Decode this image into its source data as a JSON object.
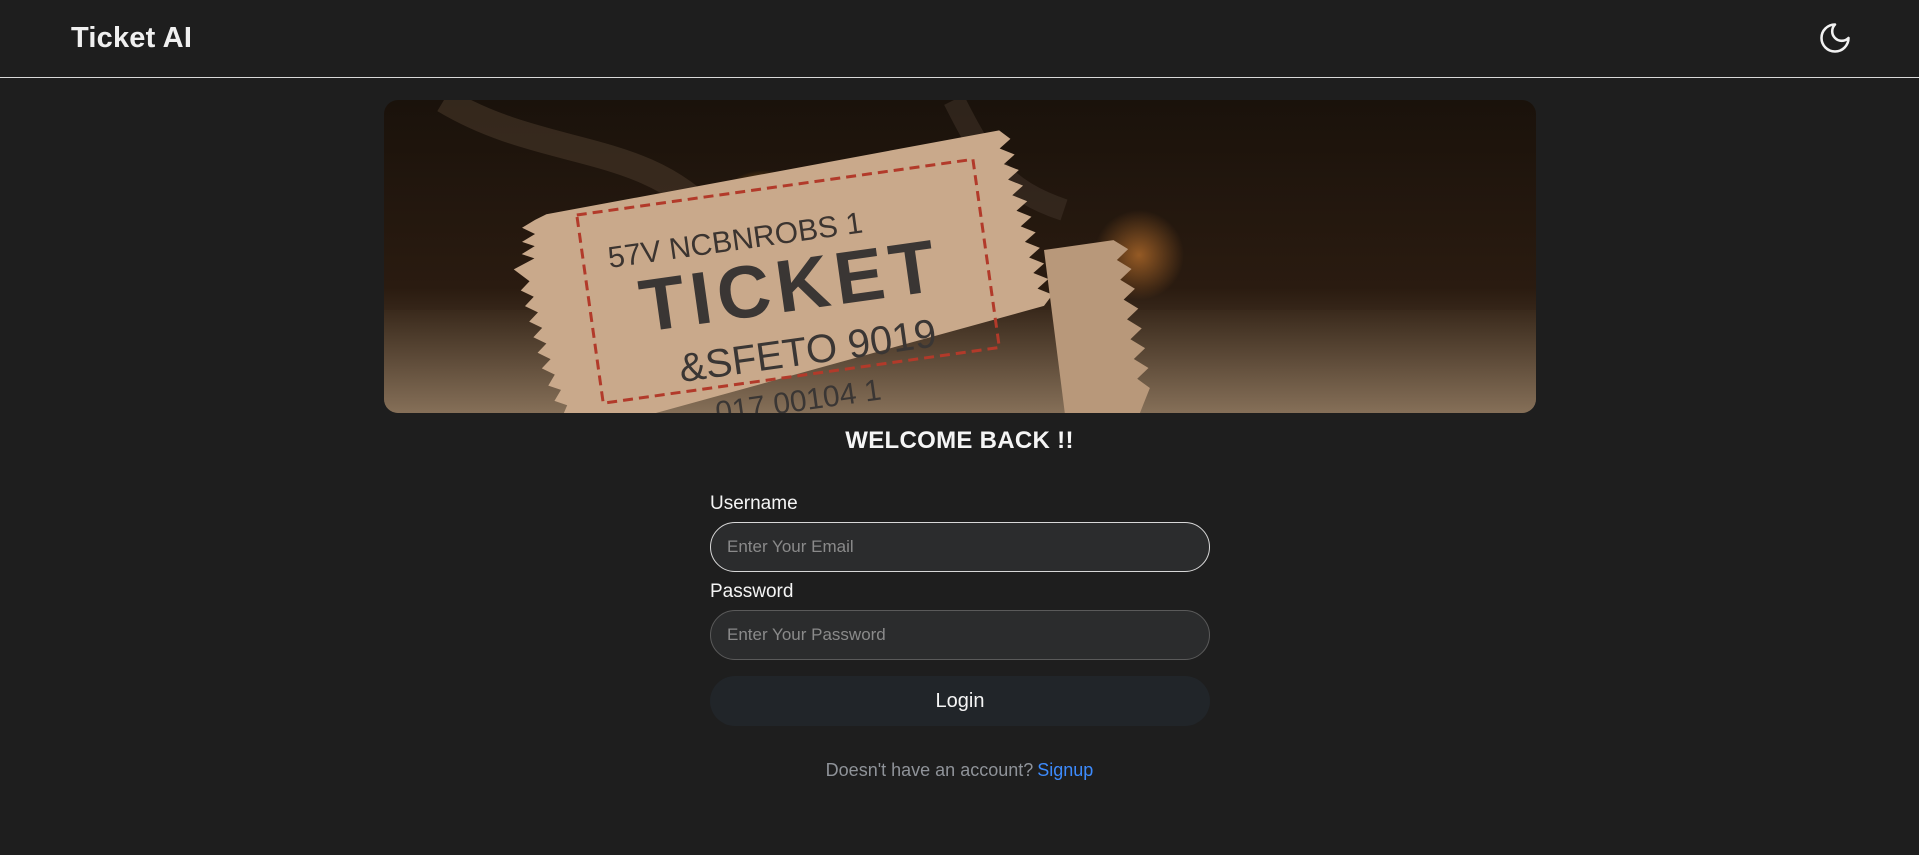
{
  "app": {
    "title": "Ticket AI"
  },
  "header": {
    "theme_toggle_icon": "moon-icon"
  },
  "hero": {
    "ticket_line1": "57V  NCBNROBS  1",
    "ticket_main": "TICKET",
    "ticket_line2": "&SFETO 9019",
    "ticket_line3": "017 00104 1"
  },
  "login": {
    "heading": "WELCOME BACK !!",
    "username_label": "Username",
    "username_placeholder": "Enter Your Email",
    "password_label": "Password",
    "password_placeholder": "Enter Your Password",
    "submit_label": "Login",
    "signup_prompt": "Doesn't have an account?",
    "signup_link": "Signup"
  },
  "colors": {
    "background": "#1e1e1e",
    "link": "#3d8bfd",
    "button": "#212529"
  }
}
